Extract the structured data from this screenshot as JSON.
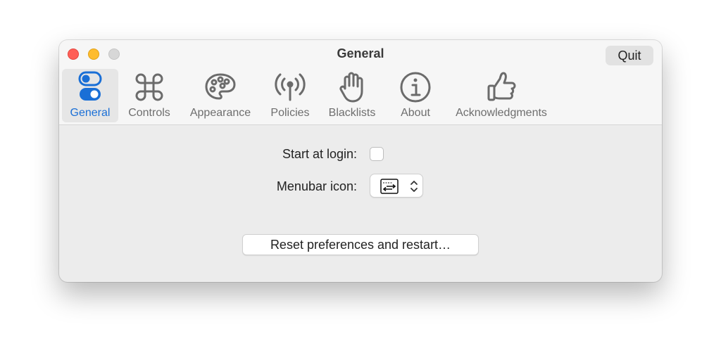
{
  "window": {
    "title": "General",
    "quit_label": "Quit"
  },
  "tabs": [
    {
      "label": "General",
      "icon": "toggles-icon",
      "active": true
    },
    {
      "label": "Controls",
      "icon": "command-icon",
      "active": false
    },
    {
      "label": "Appearance",
      "icon": "palette-icon",
      "active": false
    },
    {
      "label": "Policies",
      "icon": "antenna-icon",
      "active": false
    },
    {
      "label": "Blacklists",
      "icon": "hand-icon",
      "active": false
    },
    {
      "label": "About",
      "icon": "info-icon",
      "active": false
    },
    {
      "label": "Acknowledgments",
      "icon": "thumbs-up-icon",
      "active": false
    }
  ],
  "settings": {
    "start_at_login_label": "Start at login:",
    "start_at_login_checked": false,
    "menubar_icon_label": "Menubar icon:",
    "menubar_icon_value": "arrows-icon"
  },
  "reset_label": "Reset preferences and restart…",
  "colors": {
    "accent": "#1a6fd6",
    "close": "#ff5f57",
    "minimize": "#febc2e",
    "zoom_inactive": "#d7d7d7"
  }
}
